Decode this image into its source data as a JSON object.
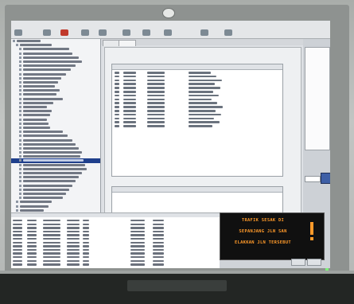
{
  "vms_sign": {
    "lines": [
      "TRAFIK SESAK DI",
      "SEPANJANG JLN SAN",
      "ELAKKAN JLN TERSEBUT"
    ],
    "warning_glyph": "!",
    "text_color": "#ff9a2a"
  },
  "colors": {
    "tree_selected": "#1f3f8c",
    "window_bg": "#dde0e4",
    "vms_bg": "#101010"
  },
  "icons": [
    "apple-logo-icon",
    "warning-icon"
  ]
}
